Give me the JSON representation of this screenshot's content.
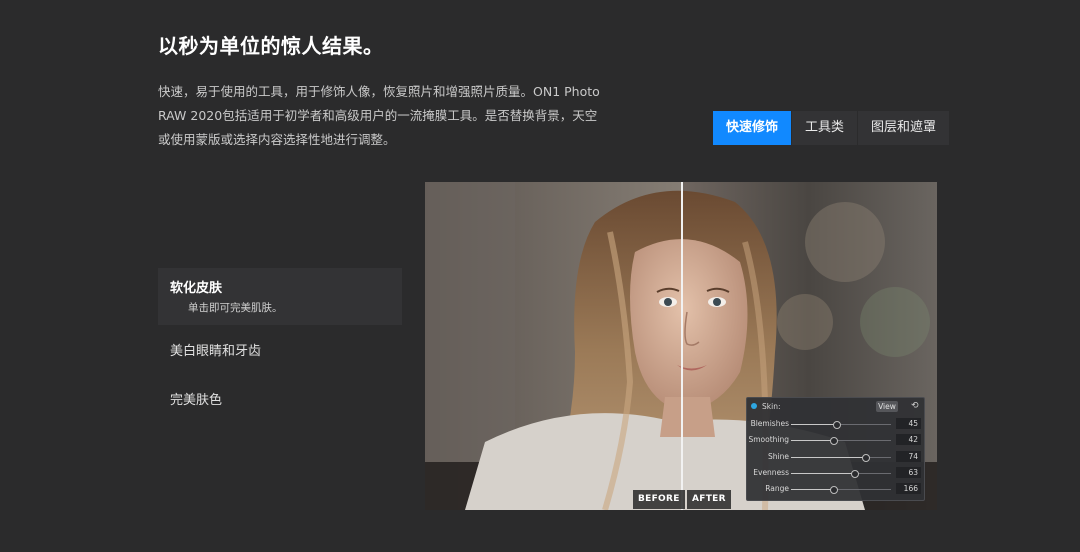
{
  "header": {
    "title": "以秒为单位的惊人结果。",
    "description": "快速，易于使用的工具，用于修饰人像，恢复照片和增强照片质量。ON1 Photo RAW 2020包括适用于初学者和高级用户的一流掩膜工具。是否替换背景，天空或使用蒙版或选择内容选择性地进行调整。"
  },
  "tabs": [
    {
      "label": "快速修饰",
      "active": true
    },
    {
      "label": "工具类",
      "active": false
    },
    {
      "label": "图层和遮罩",
      "active": false
    }
  ],
  "features": [
    {
      "title": "软化皮肤",
      "subtitle": "单击即可完美肌肤。",
      "active": true
    },
    {
      "title": "美白眼睛和牙齿",
      "active": false
    },
    {
      "title": "完美肤色",
      "active": false
    }
  ],
  "comparison": {
    "before_label": "BEFORE",
    "after_label": "AFTER",
    "panel": {
      "title": "Skin:",
      "view_label": "View",
      "reset_icon": "reset-icon",
      "sliders": [
        {
          "label": "Blemishes",
          "value": "45",
          "level": 0.45
        },
        {
          "label": "Smoothing",
          "value": "42",
          "level": 0.42
        },
        {
          "label": "Shine",
          "value": "74",
          "level": 0.74
        },
        {
          "label": "Evenness",
          "value": "63",
          "level": 0.63
        },
        {
          "label": "Range",
          "value": "166",
          "level": 0.42
        }
      ]
    }
  },
  "colors": {
    "background": "#2b2b2c",
    "accent": "#1189ff",
    "panel_dot": "#2ea6e0"
  }
}
